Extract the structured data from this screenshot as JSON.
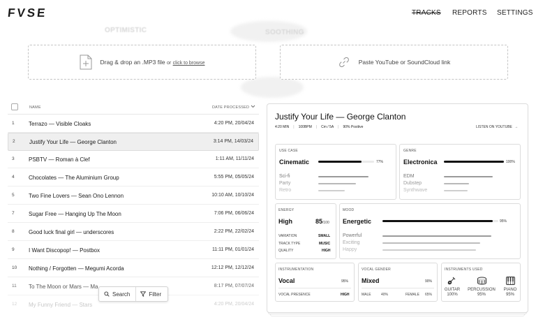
{
  "brand": {
    "logo": "FVSE"
  },
  "nav": {
    "tracks": "TRACKS",
    "reports": "REPORTS",
    "settings": "SETTINGS"
  },
  "background_labels": {
    "optimistic": "OPTIMISTIC",
    "soothing": "SOOTHING"
  },
  "upload": {
    "drop_text": "Drag & drop an .MP3 file",
    "or_text": "or",
    "browse_link": "click to browse",
    "paste_text": "Paste YouTube or SoundCloud link"
  },
  "table": {
    "col_name": "NAME",
    "col_date": "DATE PROCESSED",
    "rows": [
      {
        "num": "1",
        "name": "Terrazo — Visible Cloaks",
        "date": "4:20 PM, 20/04/24"
      },
      {
        "num": "2",
        "name": "Justify Your Life — George Clanton",
        "date": "3:14 PM, 14/03/24"
      },
      {
        "num": "3",
        "name": "PSBTV — Roman à Clef",
        "date": "1:11 AM, 11/11/24"
      },
      {
        "num": "4",
        "name": "Chocolates — The Aluminium Group",
        "date": "5:55 PM, 05/05/24"
      },
      {
        "num": "5",
        "name": "Two Fine Lovers — Sean Ono Lennon",
        "date": "10:10 AM, 10/10/24"
      },
      {
        "num": "7",
        "name": "Sugar Free — Hanging Up The Moon",
        "date": "7:06 PM, 06/06/24"
      },
      {
        "num": "8",
        "name": "Good luck final girl — underscores",
        "date": "2:22 PM, 22/02/24"
      },
      {
        "num": "9",
        "name": "I Want Discopop! — Postbox",
        "date": "11:11 PM, 01/01/24"
      },
      {
        "num": "10",
        "name": "Nothing / Forgotten — Megumi Acorda",
        "date": "12:12 PM, 12/12/24"
      },
      {
        "num": "11",
        "name": "To The Moon or Mars — Ma",
        "date": "8:17 PM, 07/07/24"
      },
      {
        "num": "12",
        "name": "My Funny Friend — Stars",
        "date": "4:20 PM, 20/04/24"
      }
    ]
  },
  "toolbar": {
    "search": "Search",
    "filter": "Filter"
  },
  "detail": {
    "title": "Justify Your Life — George Clanton",
    "meta": [
      "4:20 MIN",
      "100BPM",
      "Cm / 5A",
      "90% Positive"
    ],
    "listen_link": "LISTEN ON YOUTUBE",
    "use_case": {
      "label": "USE CASE",
      "top": "Cinematic",
      "top_pct": "77%",
      "top_value": 0.77,
      "others": [
        "Sci-fi",
        "Party",
        "Retro"
      ]
    },
    "genre": {
      "label": "GENRE",
      "top": "Electronica",
      "top_pct": "100%",
      "top_value": 1.0,
      "others": [
        "EDM",
        "Dubstep",
        "Synthwave"
      ]
    },
    "energy": {
      "label": "ENERGY",
      "level": "High",
      "score": "85",
      "score_max": "/100",
      "rows": [
        {
          "k": "VARIATION",
          "v": "SMALL"
        },
        {
          "k": "TRACK TYPE",
          "v": "MUSIC"
        },
        {
          "k": "QUALITY",
          "v": "HIGH"
        }
      ]
    },
    "mood": {
      "label": "MOOD",
      "top": "Energetic",
      "top_pct": "95%",
      "top_value": 0.95,
      "others": [
        "Powerful",
        "Exciting",
        "Happy"
      ]
    },
    "instrumentation": {
      "label": "INSTRUMENTATION",
      "value": "Vocal",
      "pct": "95%",
      "presence_label": "VOCAL PRESENCE",
      "presence_value": "HIGH"
    },
    "vocal_gender": {
      "label": "VOCAL GENDER",
      "value": "Mixed",
      "pct": "90%",
      "male_label": "MALE",
      "male_pct": "40%",
      "female_label": "FEMALE",
      "female_pct": "65%"
    },
    "instruments": {
      "label": "INSTRUMENTS USED",
      "items": [
        {
          "name": "GUITAR",
          "pct": "100%",
          "icon": "guitar-icon"
        },
        {
          "name": "PERCUSSION",
          "pct": "95%",
          "icon": "drum-icon"
        },
        {
          "name": "PIANO",
          "pct": "95%",
          "icon": "piano-icon"
        }
      ]
    }
  }
}
